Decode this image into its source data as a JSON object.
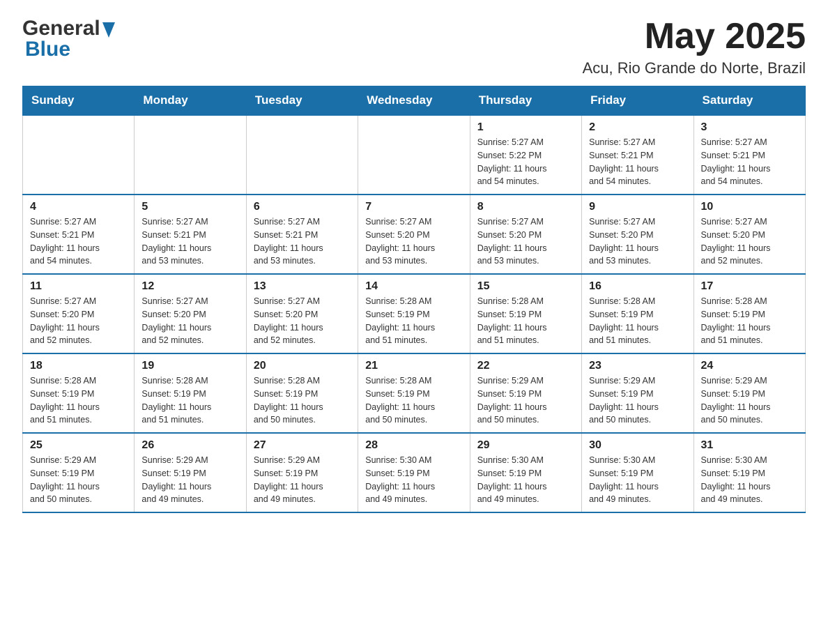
{
  "header": {
    "logo_general": "General",
    "logo_blue": "Blue",
    "month_title": "May 2025",
    "location": "Acu, Rio Grande do Norte, Brazil"
  },
  "days_of_week": [
    "Sunday",
    "Monday",
    "Tuesday",
    "Wednesday",
    "Thursday",
    "Friday",
    "Saturday"
  ],
  "weeks": [
    [
      {
        "day": "",
        "info": ""
      },
      {
        "day": "",
        "info": ""
      },
      {
        "day": "",
        "info": ""
      },
      {
        "day": "",
        "info": ""
      },
      {
        "day": "1",
        "info": "Sunrise: 5:27 AM\nSunset: 5:22 PM\nDaylight: 11 hours\nand 54 minutes."
      },
      {
        "day": "2",
        "info": "Sunrise: 5:27 AM\nSunset: 5:21 PM\nDaylight: 11 hours\nand 54 minutes."
      },
      {
        "day": "3",
        "info": "Sunrise: 5:27 AM\nSunset: 5:21 PM\nDaylight: 11 hours\nand 54 minutes."
      }
    ],
    [
      {
        "day": "4",
        "info": "Sunrise: 5:27 AM\nSunset: 5:21 PM\nDaylight: 11 hours\nand 54 minutes."
      },
      {
        "day": "5",
        "info": "Sunrise: 5:27 AM\nSunset: 5:21 PM\nDaylight: 11 hours\nand 53 minutes."
      },
      {
        "day": "6",
        "info": "Sunrise: 5:27 AM\nSunset: 5:21 PM\nDaylight: 11 hours\nand 53 minutes."
      },
      {
        "day": "7",
        "info": "Sunrise: 5:27 AM\nSunset: 5:20 PM\nDaylight: 11 hours\nand 53 minutes."
      },
      {
        "day": "8",
        "info": "Sunrise: 5:27 AM\nSunset: 5:20 PM\nDaylight: 11 hours\nand 53 minutes."
      },
      {
        "day": "9",
        "info": "Sunrise: 5:27 AM\nSunset: 5:20 PM\nDaylight: 11 hours\nand 53 minutes."
      },
      {
        "day": "10",
        "info": "Sunrise: 5:27 AM\nSunset: 5:20 PM\nDaylight: 11 hours\nand 52 minutes."
      }
    ],
    [
      {
        "day": "11",
        "info": "Sunrise: 5:27 AM\nSunset: 5:20 PM\nDaylight: 11 hours\nand 52 minutes."
      },
      {
        "day": "12",
        "info": "Sunrise: 5:27 AM\nSunset: 5:20 PM\nDaylight: 11 hours\nand 52 minutes."
      },
      {
        "day": "13",
        "info": "Sunrise: 5:27 AM\nSunset: 5:20 PM\nDaylight: 11 hours\nand 52 minutes."
      },
      {
        "day": "14",
        "info": "Sunrise: 5:28 AM\nSunset: 5:19 PM\nDaylight: 11 hours\nand 51 minutes."
      },
      {
        "day": "15",
        "info": "Sunrise: 5:28 AM\nSunset: 5:19 PM\nDaylight: 11 hours\nand 51 minutes."
      },
      {
        "day": "16",
        "info": "Sunrise: 5:28 AM\nSunset: 5:19 PM\nDaylight: 11 hours\nand 51 minutes."
      },
      {
        "day": "17",
        "info": "Sunrise: 5:28 AM\nSunset: 5:19 PM\nDaylight: 11 hours\nand 51 minutes."
      }
    ],
    [
      {
        "day": "18",
        "info": "Sunrise: 5:28 AM\nSunset: 5:19 PM\nDaylight: 11 hours\nand 51 minutes."
      },
      {
        "day": "19",
        "info": "Sunrise: 5:28 AM\nSunset: 5:19 PM\nDaylight: 11 hours\nand 51 minutes."
      },
      {
        "day": "20",
        "info": "Sunrise: 5:28 AM\nSunset: 5:19 PM\nDaylight: 11 hours\nand 50 minutes."
      },
      {
        "day": "21",
        "info": "Sunrise: 5:28 AM\nSunset: 5:19 PM\nDaylight: 11 hours\nand 50 minutes."
      },
      {
        "day": "22",
        "info": "Sunrise: 5:29 AM\nSunset: 5:19 PM\nDaylight: 11 hours\nand 50 minutes."
      },
      {
        "day": "23",
        "info": "Sunrise: 5:29 AM\nSunset: 5:19 PM\nDaylight: 11 hours\nand 50 minutes."
      },
      {
        "day": "24",
        "info": "Sunrise: 5:29 AM\nSunset: 5:19 PM\nDaylight: 11 hours\nand 50 minutes."
      }
    ],
    [
      {
        "day": "25",
        "info": "Sunrise: 5:29 AM\nSunset: 5:19 PM\nDaylight: 11 hours\nand 50 minutes."
      },
      {
        "day": "26",
        "info": "Sunrise: 5:29 AM\nSunset: 5:19 PM\nDaylight: 11 hours\nand 49 minutes."
      },
      {
        "day": "27",
        "info": "Sunrise: 5:29 AM\nSunset: 5:19 PM\nDaylight: 11 hours\nand 49 minutes."
      },
      {
        "day": "28",
        "info": "Sunrise: 5:30 AM\nSunset: 5:19 PM\nDaylight: 11 hours\nand 49 minutes."
      },
      {
        "day": "29",
        "info": "Sunrise: 5:30 AM\nSunset: 5:19 PM\nDaylight: 11 hours\nand 49 minutes."
      },
      {
        "day": "30",
        "info": "Sunrise: 5:30 AM\nSunset: 5:19 PM\nDaylight: 11 hours\nand 49 minutes."
      },
      {
        "day": "31",
        "info": "Sunrise: 5:30 AM\nSunset: 5:19 PM\nDaylight: 11 hours\nand 49 minutes."
      }
    ]
  ]
}
